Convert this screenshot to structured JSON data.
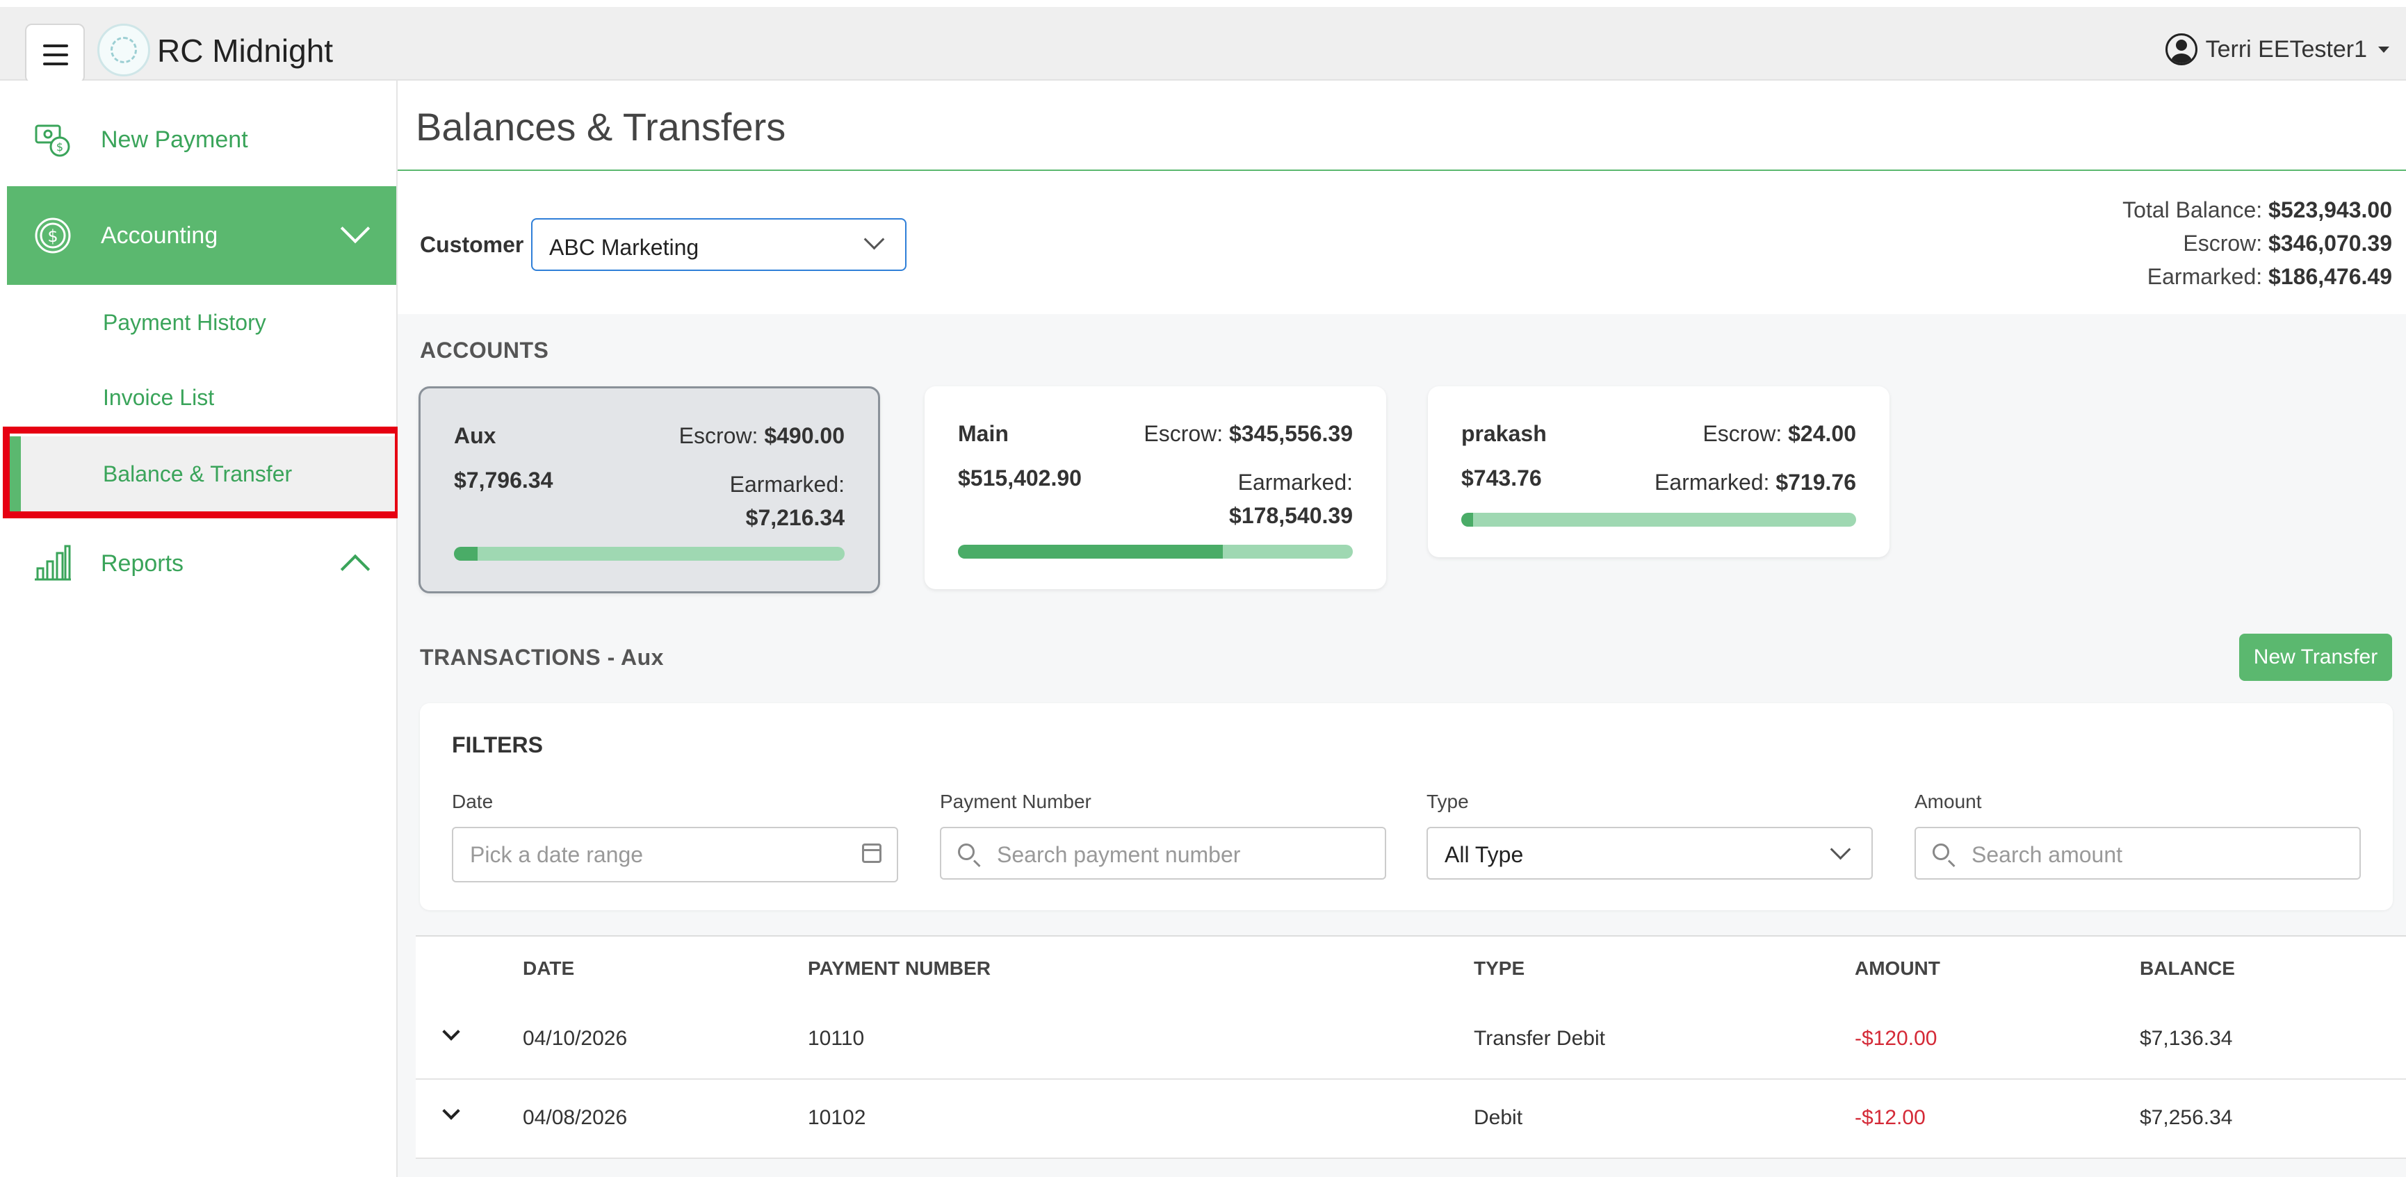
{
  "app": {
    "title": "RC Midnight",
    "user": "Terri EETester1"
  },
  "sidebar": {
    "new_payment": "New Payment",
    "accounting": "Accounting",
    "payment_history": "Payment History",
    "invoice_list": "Invoice List",
    "balance_transfer": "Balance & Transfer",
    "reports": "Reports"
  },
  "page": {
    "title": "Balances & Transfers"
  },
  "customer": {
    "label": "Customer",
    "selected": "ABC Marketing"
  },
  "totals": {
    "total_label": "Total Balance:",
    "total_value": "$523,943.00",
    "escrow_label": "Escrow:",
    "escrow_value": "$346,070.39",
    "earmarked_label": "Earmarked:",
    "earmarked_value": "$186,476.49"
  },
  "accounts": {
    "title": "ACCOUNTS",
    "items": [
      {
        "name": "Aux",
        "escrow_label": "Escrow:",
        "escrow": "$490.00",
        "balance": "$7,796.34",
        "earmarked_label": "Earmarked:",
        "earmarked": "$7,216.34",
        "progress": 0.06
      },
      {
        "name": "Main",
        "escrow_label": "Escrow:",
        "escrow": "$345,556.39",
        "balance": "$515,402.90",
        "earmarked_label": "Earmarked:",
        "earmarked": "$178,540.39",
        "progress": 0.67
      },
      {
        "name": "prakash",
        "escrow_label": "Escrow:",
        "escrow": "$24.00",
        "balance": "$743.76",
        "earmarked_label": "Earmarked:",
        "earmarked": "$719.76",
        "progress": 0.03
      }
    ]
  },
  "transactions": {
    "title": "TRANSACTIONS - Aux",
    "new_transfer": "New Transfer",
    "filters": {
      "title": "FILTERS",
      "date_label": "Date",
      "date_placeholder": "Pick a date range",
      "payment_label": "Payment Number",
      "payment_placeholder": "Search payment number",
      "type_label": "Type",
      "type_value": "All Type",
      "amount_label": "Amount",
      "amount_placeholder": "Search amount"
    },
    "columns": [
      "DATE",
      "PAYMENT NUMBER",
      "TYPE",
      "AMOUNT",
      "BALANCE"
    ],
    "rows": [
      {
        "date": "04/10/2026",
        "payment_number": "10110",
        "type": "Transfer Debit",
        "amount": "-$120.00",
        "balance": "$7,136.34"
      },
      {
        "date": "04/08/2026",
        "payment_number": "10102",
        "type": "Debit",
        "amount": "-$12.00",
        "balance": "$7,256.34"
      }
    ]
  },
  "colors": {
    "brand_green": "#5bb86f",
    "progress_dark": "#4aac67",
    "progress_light": "#9fd8b2",
    "negative": "#d42a37",
    "highlight": "#e60012"
  }
}
